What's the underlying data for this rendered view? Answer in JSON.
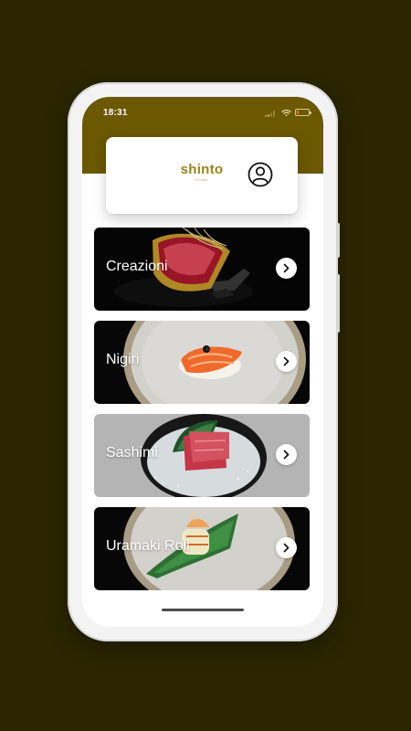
{
  "status_bar": {
    "time": "18:31",
    "battery_level": 0.2,
    "colors": {
      "battery_low": "#ff6a3d"
    }
  },
  "brand": {
    "name": "shinto",
    "subtitle": "Private"
  },
  "header": {
    "background_color": "#6b5800",
    "profile_icon": "user-circle-icon"
  },
  "menu": {
    "items": [
      {
        "label": "Creazioni",
        "image_icon": "taco-sushi-image"
      },
      {
        "label": "Nigiri",
        "image_icon": "nigiri-image"
      },
      {
        "label": "Sashimi",
        "image_icon": "sashimi-image"
      },
      {
        "label": "Uramaki Roll",
        "image_icon": "uramaki-image"
      }
    ],
    "chevron_icon": "chevron-right-icon"
  },
  "colors": {
    "outer_background": "#2b2600",
    "accent_gold": "#9a8415"
  }
}
